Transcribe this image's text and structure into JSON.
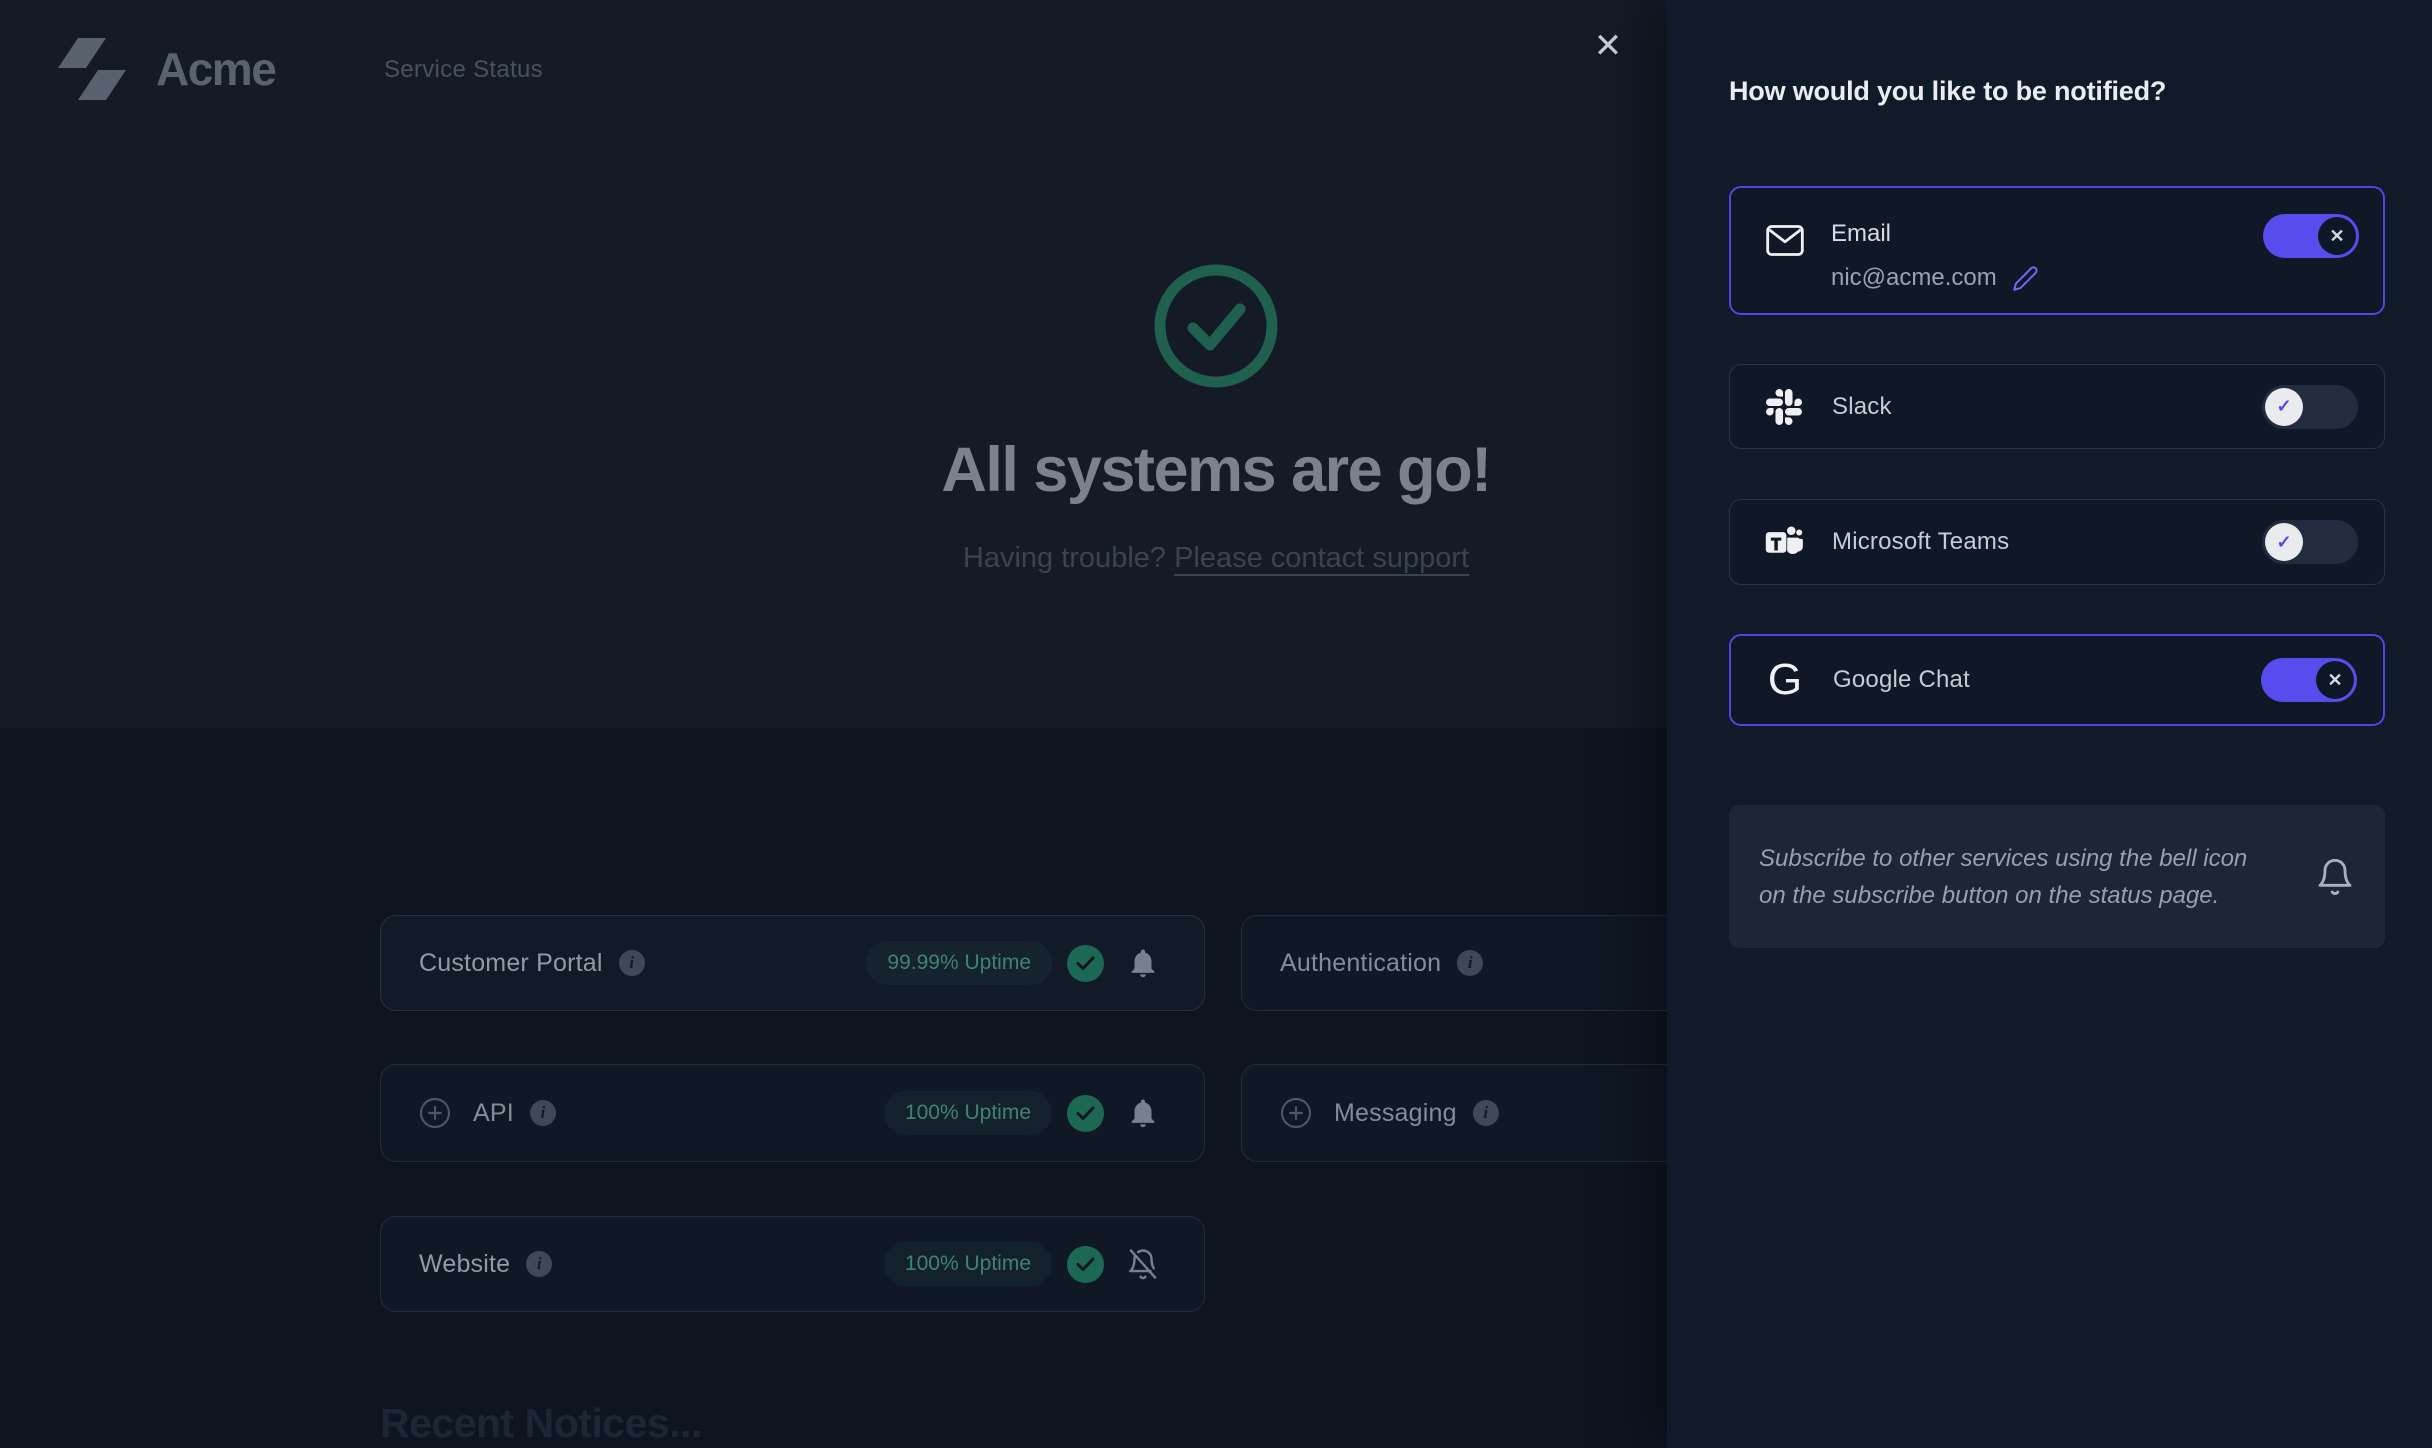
{
  "brand": {
    "name": "Acme",
    "page_subtitle": "Service Status"
  },
  "hero": {
    "title": "All systems are go!",
    "trouble_text": "Having trouble? ",
    "support_link_text": "Please contact support"
  },
  "services": {
    "customer_portal": {
      "label": "Customer Portal",
      "uptime": "99.99% Uptime",
      "bell": "subscribed"
    },
    "authentication": {
      "label": "Authentication"
    },
    "api": {
      "label": "API",
      "uptime": "100% Uptime",
      "bell": "subscribed",
      "expandable": true
    },
    "messaging": {
      "label": "Messaging",
      "expandable": true
    },
    "website": {
      "label": "Website",
      "uptime": "100% Uptime",
      "bell": "muted"
    }
  },
  "notices": {
    "title": "Recent Notices..."
  },
  "panel": {
    "title": "How would you like to be notified?",
    "email": {
      "label": "Email",
      "value": "nic@acme.com",
      "enabled": true
    },
    "slack": {
      "label": "Slack",
      "enabled": false
    },
    "teams": {
      "label": "Microsoft Teams",
      "enabled": false
    },
    "google_chat": {
      "label": "Google Chat",
      "enabled": true
    },
    "note": "Subscribe to other services using the bell icon on the subscribe button on the status page."
  },
  "icons": {
    "close": "✕",
    "cross": "✕",
    "check": "✓",
    "info": "i",
    "google_g": "G"
  },
  "colors": {
    "accent_purple": "#5145e5",
    "toggle_on": "#584cec",
    "success_circle": "#1d6852",
    "uptime_text": "#41836e",
    "hero_check": "#20604f",
    "hero_bg": "#141b27",
    "page_bg": "#0e1521",
    "panel_bg": "#111a29"
  }
}
